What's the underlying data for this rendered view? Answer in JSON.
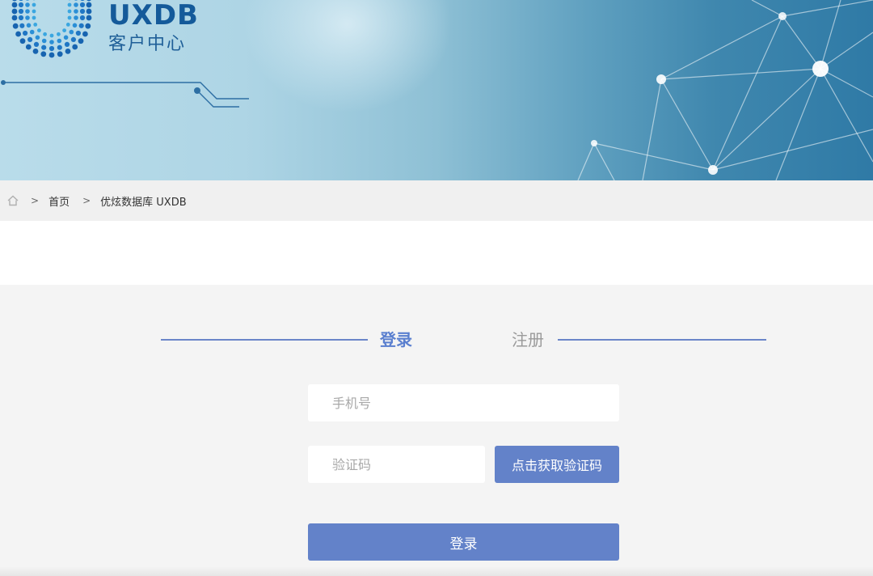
{
  "brand": {
    "title": "UXDB",
    "subtitle": "客户中心"
  },
  "icons": {
    "logo": "uxdb-dotted-u-logo",
    "home": "home-icon",
    "banner": "network-nodes-decoration"
  },
  "breadcrumb": {
    "separator": ">",
    "items": [
      "首页",
      "优炫数据库 UXDB"
    ]
  },
  "auth": {
    "tabs": [
      {
        "label": "登录",
        "active": true
      },
      {
        "label": "注册",
        "active": false
      }
    ],
    "phone_placeholder": "手机号",
    "code_placeholder": "验证码",
    "get_code_label": "点击获取验证码",
    "submit_label": "登录"
  },
  "colors": {
    "accent": "#6382c9",
    "tab_active": "#5a7fcf",
    "tab_inactive": "#9a9a9a",
    "brand_blue": "#145a9a"
  }
}
